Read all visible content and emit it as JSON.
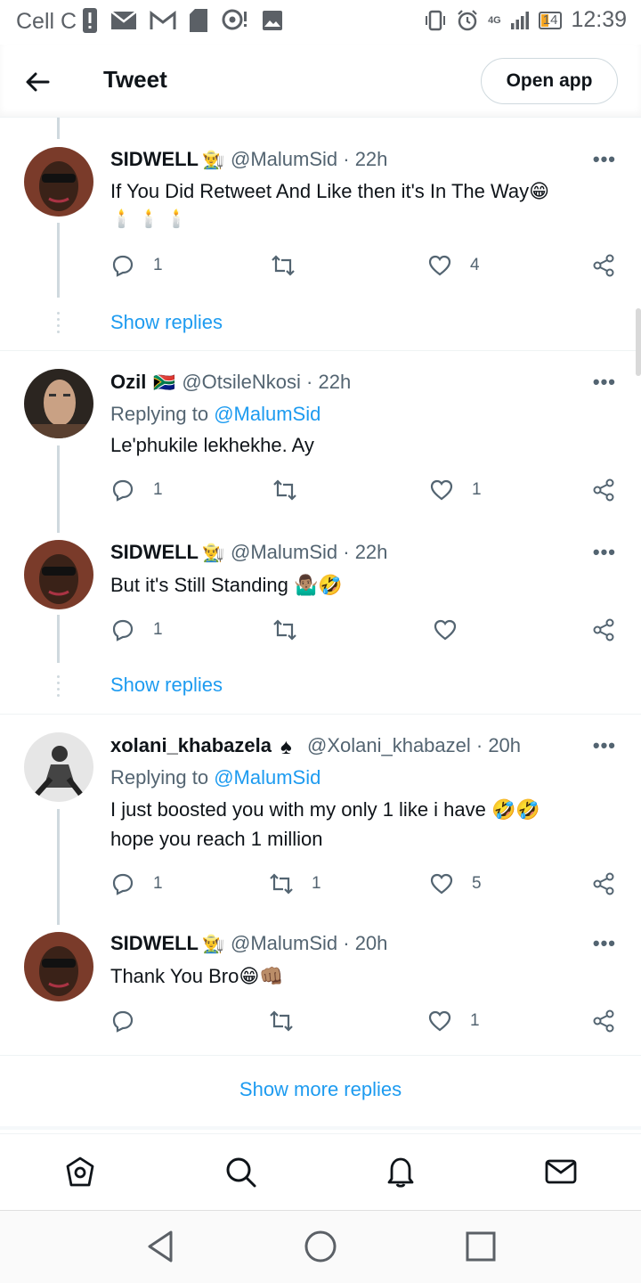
{
  "status_bar": {
    "carrier": "Cell C",
    "network": "4G",
    "battery": "14",
    "time": "12:39",
    "left_icons": [
      "alert-icon",
      "mail-icon",
      "gmail-icon",
      "sd-card-icon",
      "hotspot-icon",
      "image-icon"
    ],
    "right_icons": [
      "vibrate-icon",
      "alarm-icon",
      "signal-icon",
      "battery-icon"
    ]
  },
  "header": {
    "title": "Tweet",
    "open_app_label": "Open app"
  },
  "tweets": [
    {
      "name": "SIDWELL",
      "name_emoji": "👨‍🌾",
      "handle": "@MalumSid · 22h",
      "text": "If You Did Retweet And Like then it's In The Way😁",
      "text2": "🕯️🕯️🕯️",
      "reply_count": "1",
      "retweet_count": "",
      "like_count": "4",
      "show_replies": "Show replies"
    },
    {
      "name": "Ozil",
      "name_emoji": "🇿🇦",
      "handle": "@OtsileNkosi · 22h",
      "replying_prefix": "Replying to ",
      "replying_to": "@MalumSid",
      "text": "Le'phukile lekhekhe. Ay",
      "reply_count": "1",
      "retweet_count": "",
      "like_count": "1"
    },
    {
      "name": "SIDWELL",
      "name_emoji": "👨‍🌾",
      "handle": "@MalumSid · 22h",
      "text": "But it's Still Standing 🤷🏽‍♂️🤣",
      "reply_count": "1",
      "retweet_count": "",
      "like_count": "",
      "show_replies": "Show replies"
    },
    {
      "name": "xolani_khabazela",
      "name_emoji": "♠",
      "handle": "@Xolani_khabazel · 20h",
      "replying_prefix": "Replying to ",
      "replying_to": "@MalumSid",
      "text": "I just boosted you with my only 1 like i have 🤣🤣",
      "text2": "hope you reach 1 million",
      "reply_count": "1",
      "retweet_count": "1",
      "like_count": "5"
    },
    {
      "name": "SIDWELL",
      "name_emoji": "👨‍🌾",
      "handle": "@MalumSid · 20h",
      "text": "Thank You Bro😁👊🏽",
      "reply_count": "",
      "retweet_count": "",
      "like_count": "1"
    }
  ],
  "show_more_replies": "Show more replies",
  "more_menu": "•••",
  "colors": {
    "accent": "#1d9bf0",
    "text": "#0f1419",
    "secondary": "#536471",
    "border": "#eff3f4"
  }
}
